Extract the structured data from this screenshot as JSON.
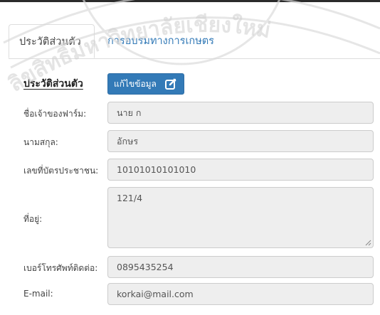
{
  "tabs": [
    {
      "label": "ประวัติส่วนตัว",
      "active": true
    },
    {
      "label": "การอบรมทางการเกษตร",
      "active": false
    }
  ],
  "profile": {
    "section_title": "ประวัติส่วนตัว",
    "edit_button": "แก้ไขข้อมูล",
    "fields": [
      {
        "label": "ชื่อเจ้าของฟาร์ม:",
        "value": "นาย ก"
      },
      {
        "label": "นามสกุล:",
        "value": "อักษร"
      },
      {
        "label": "เลขที่บัตรประชาชน:",
        "value": "10101010101010"
      },
      {
        "label": "ที่อยู่:",
        "value": "121/4"
      },
      {
        "label": "เบอร์โทรศัพท์ติดต่อ:",
        "value": "0895435254"
      },
      {
        "label": "E-mail:",
        "value": "korkai@mail.com"
      }
    ]
  },
  "watermark": {
    "text": "ลิขสิทธิ์มหาวิทยาลัยเชียงใหม่"
  },
  "colors": {
    "accent": "#337ab7",
    "field_bg": "#eeeeee",
    "border": "#dddddd"
  }
}
